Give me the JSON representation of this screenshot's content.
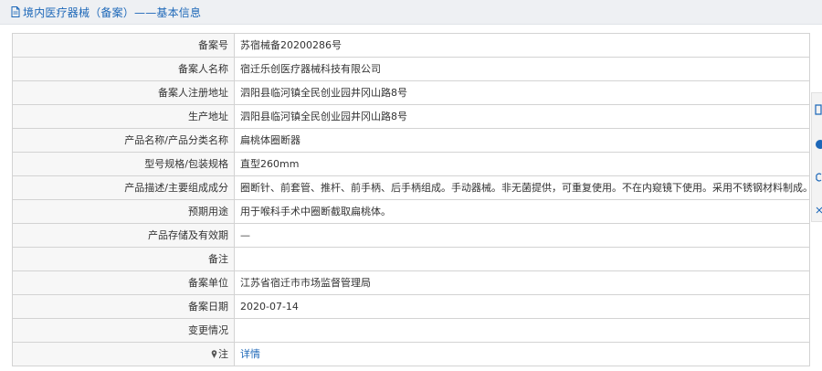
{
  "header": {
    "title": "境内医疗器械（备案）——基本信息",
    "icon": "document-icon"
  },
  "rows": [
    {
      "label": "备案号",
      "value": "苏宿械备20200286号"
    },
    {
      "label": "备案人名称",
      "value": "宿迁乐创医疗器械科技有限公司"
    },
    {
      "label": "备案人注册地址",
      "value": "泗阳县临河镇全民创业园井冈山路8号"
    },
    {
      "label": "生产地址",
      "value": "泗阳县临河镇全民创业园井冈山路8号"
    },
    {
      "label": "产品名称/产品分类名称",
      "value": "扁桃体圈断器"
    },
    {
      "label": "型号规格/包装规格",
      "value": "直型260mm"
    },
    {
      "label": "产品描述/主要组成成分",
      "value": "圈断针、前套管、推杆、前手柄、后手柄组成。手动器械。非无菌提供，可重复使用。不在内窥镜下使用。采用不锈钢材料制成。"
    },
    {
      "label": "预期用途",
      "value": "用于喉科手术中圈断截取扁桃体。"
    },
    {
      "label": "产品存储及有效期",
      "value": "—"
    },
    {
      "label": "备注",
      "value": ""
    },
    {
      "label": "备案单位",
      "value": "江苏省宿迁市市场监督管理局"
    },
    {
      "label": "备案日期",
      "value": "2020-07-14"
    },
    {
      "label": "变更情况",
      "value": ""
    }
  ],
  "note_row": {
    "label": "注",
    "icon": "pin-icon",
    "link": "详情"
  },
  "colors": {
    "accent": "#1c67b8",
    "label_bg": "#f7f7f7",
    "border": "#d3d3d3",
    "header_bg": "#eef0f3"
  }
}
